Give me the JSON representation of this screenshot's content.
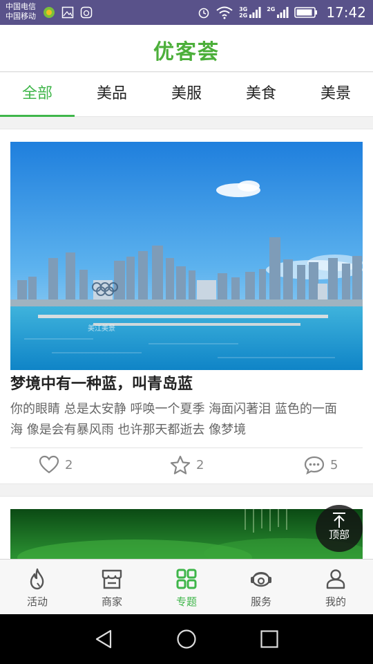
{
  "status_bar": {
    "carrier_1": "中国电信",
    "carrier_2": "中国移动",
    "network_1": "3G",
    "network_2": "2G",
    "network_3": "2G",
    "network_4": "4G",
    "time": "17:42"
  },
  "header": {
    "logo_text": "优客荟",
    "brand_color": "#4caf3a"
  },
  "tabs": [
    {
      "label": "全部",
      "active": true
    },
    {
      "label": "美品"
    },
    {
      "label": "美服"
    },
    {
      "label": "美食"
    },
    {
      "label": "美景"
    }
  ],
  "card": {
    "image_watermark": "美江美景",
    "title": "梦境中有一种蓝，叫青岛蓝",
    "description_line_1": "你的眼睛 总是太安静 呼唤一个夏季 海面闪著泪 蓝色的一面",
    "description_line_2": "海 像是会有暴风雨 也许那天都逝去 像梦境",
    "likes": "2",
    "favorites": "2",
    "comments": "5"
  },
  "back_to_top": {
    "label": "顶部"
  },
  "bottom_nav": [
    {
      "label": "活动",
      "icon": "flame-icon"
    },
    {
      "label": "商家",
      "icon": "store-icon"
    },
    {
      "label": "专题",
      "icon": "grid-icon",
      "active": true
    },
    {
      "label": "服务",
      "icon": "headset-icon"
    },
    {
      "label": "我的",
      "icon": "user-icon"
    }
  ],
  "colors": {
    "accent": "#3fb64a",
    "status_bar": "#59528a"
  }
}
